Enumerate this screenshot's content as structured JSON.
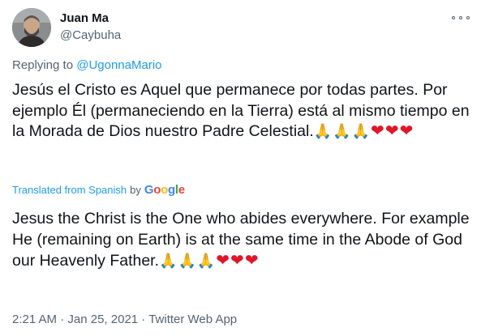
{
  "author": {
    "display_name": "Juan Ma",
    "handle": "@Caybuha",
    "avatar": "avatar-photo"
  },
  "more_icon": "more-options-icon",
  "replying_to": {
    "prefix": "Replying to ",
    "mention": "@UgonnaMario"
  },
  "tweet": {
    "text": "Jesús el Cristo es Aquel que permanece por todas partes. Por ejemplo Él (permaneciendo en la Tierra) está al mismo tiempo en la Morada de Dios nuestro Padre Celestial.",
    "emojis": "🙏🙏🙏❤❤❤"
  },
  "translation": {
    "label": "Translated from Spanish",
    "by": "by",
    "provider": "Google",
    "provider_colors": [
      "#4285f4",
      "#ea4335",
      "#fbbc05",
      "#4285f4",
      "#34a853",
      "#ea4335"
    ],
    "text": "Jesus the Christ is the One who abides everywhere. For example He (remaining on Earth) is at the same time in the Abode of God our Heavenly Father.",
    "emojis": "🙏🙏🙏❤❤❤"
  },
  "meta": {
    "time": "2:21 AM",
    "separator1": " · ",
    "date": "Jan 25, 2021",
    "separator2": " · ",
    "source": "Twitter Web App"
  },
  "colors": {
    "link": "#1d9bf0",
    "secondary_text": "#536471",
    "primary_text": "#0f1419",
    "heart": "#e0162b"
  }
}
